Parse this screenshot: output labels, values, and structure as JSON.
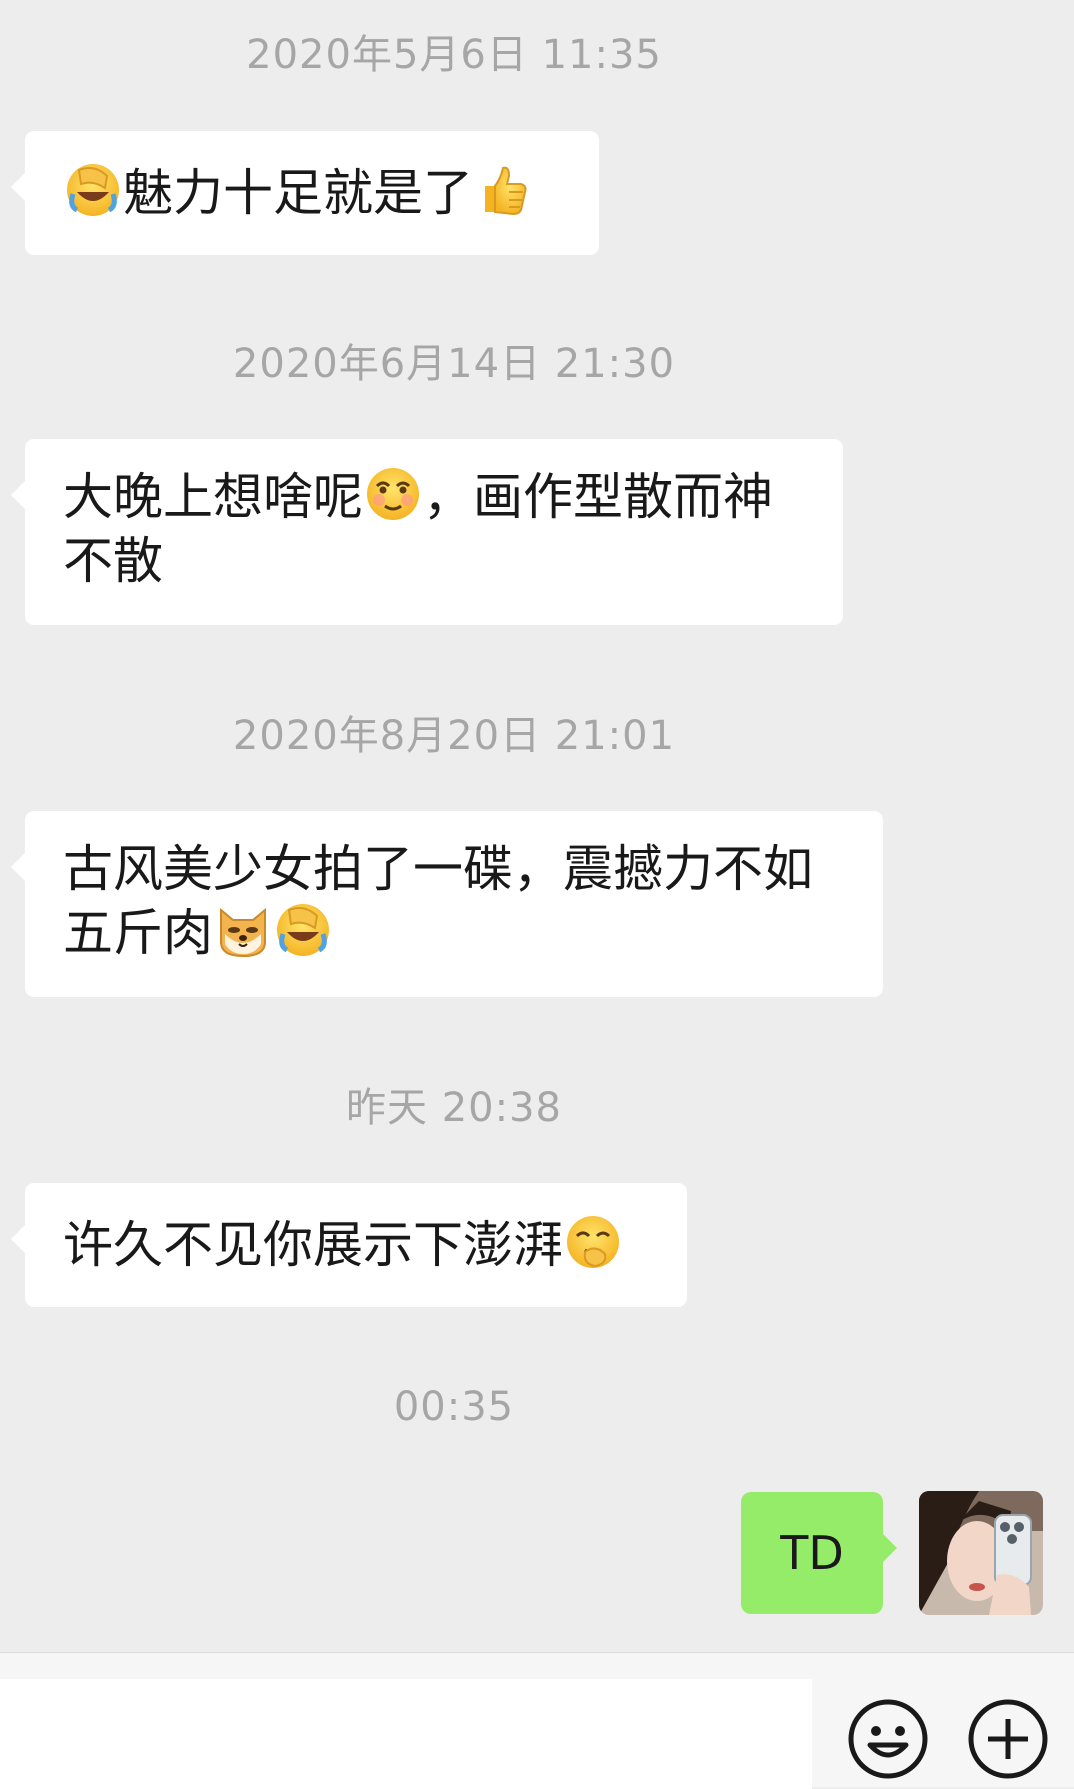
{
  "messages": [
    {
      "timestamp": "2020年5月6日 11:35",
      "lines": [
        [
          {
            "emoji": "facepalm-laugh"
          },
          {
            "text": "魅力十足就是了"
          },
          {
            "emoji": "thumbs-up"
          }
        ]
      ]
    },
    {
      "timestamp": "2020年6月14日 21:30",
      "lines": [
        [
          {
            "text": "大晚上想啥呢"
          },
          {
            "emoji": "smirk-face"
          },
          {
            "text": "，画作型散而神"
          }
        ],
        [
          {
            "text": "不散"
          }
        ]
      ]
    },
    {
      "timestamp": "2020年8月20日 21:01",
      "lines": [
        [
          {
            "text": "古风美少女拍了一碟，震撼力不如"
          }
        ],
        [
          {
            "text": "五斤肉"
          },
          {
            "emoji": "doge"
          },
          {
            "emoji": "facepalm-laugh"
          }
        ]
      ]
    },
    {
      "timestamp": "昨天 20:38",
      "lines": [
        [
          {
            "text": "许久不见你展示下澎湃"
          },
          {
            "emoji": "thinking-giggle"
          }
        ]
      ]
    }
  ],
  "last_timestamp": "00:35",
  "outgoing": {
    "text": "TD",
    "color": "#95ec69"
  },
  "avatar": {
    "icon": "profile-photo"
  },
  "input": {
    "value": "",
    "placeholder": ""
  },
  "toolbar": {
    "emoji_icon": "smiley-icon",
    "more_icon": "plus-circle-icon"
  },
  "colors": {
    "background": "#ededed",
    "incoming_bubble": "#ffffff",
    "outgoing_bubble": "#95ec69",
    "timestamp": "#a6a6a6"
  }
}
